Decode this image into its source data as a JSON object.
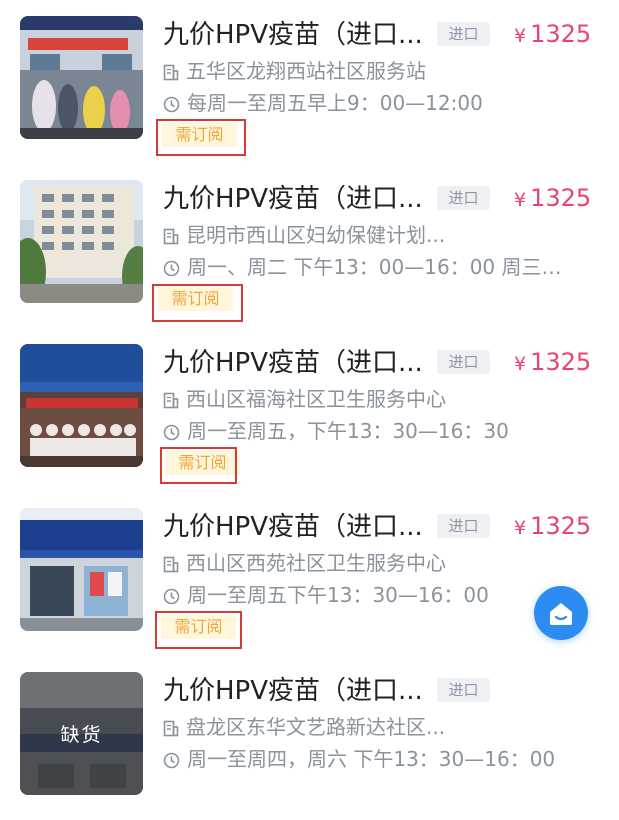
{
  "items": [
    {
      "title": "九价HPV疫苗（进口...",
      "tag": "进口",
      "currency": "¥",
      "price": "1325",
      "address": "五华区龙翔西站社区服务站",
      "hours": "每周一至周五早上9：00—12:00",
      "badge": "需订阅",
      "thumb_icon": "clinic-photo-1"
    },
    {
      "title": "九价HPV疫苗（进口...",
      "tag": "进口",
      "currency": "¥",
      "price": "1325",
      "address": "昆明市西山区妇幼保健计划...",
      "hours": "周一、周二 下午13：00—16：00 周三、...",
      "badge": "需订阅",
      "thumb_icon": "clinic-photo-2"
    },
    {
      "title": "九价HPV疫苗（进口...",
      "tag": "进口",
      "currency": "¥",
      "price": "1325",
      "address": "西山区福海社区卫生服务中心",
      "hours": "周一至周五，下午13：30—16：30",
      "badge": "需订阅",
      "thumb_icon": "clinic-photo-3"
    },
    {
      "title": "九价HPV疫苗（进口...",
      "tag": "进口",
      "currency": "¥",
      "price": "1325",
      "address": "西山区西苑社区卫生服务中心",
      "hours": "周一至周五下午13：30—16：00",
      "badge": "需订阅",
      "thumb_icon": "clinic-photo-4"
    },
    {
      "title": "九价HPV疫苗（进口...",
      "tag": "进口",
      "address": "盘龙区东华文艺路新达社区...",
      "hours": "周一至周四，周六 下午13：30—16：00",
      "status_overlay": "缺货",
      "thumb_icon": "clinic-photo-5"
    }
  ],
  "colors": {
    "price": "#e94372",
    "badge_text": "#f3a53a",
    "badge_bg": "#fff6dc",
    "badge_frame": "#d63a34",
    "float_button": "#2d8cf0",
    "meta_text": "#8a929c",
    "tag_bg": "#eef0f3"
  },
  "icons": {
    "address": "building-icon",
    "hours": "clock-icon",
    "float_button": "home-smile-icon"
  }
}
